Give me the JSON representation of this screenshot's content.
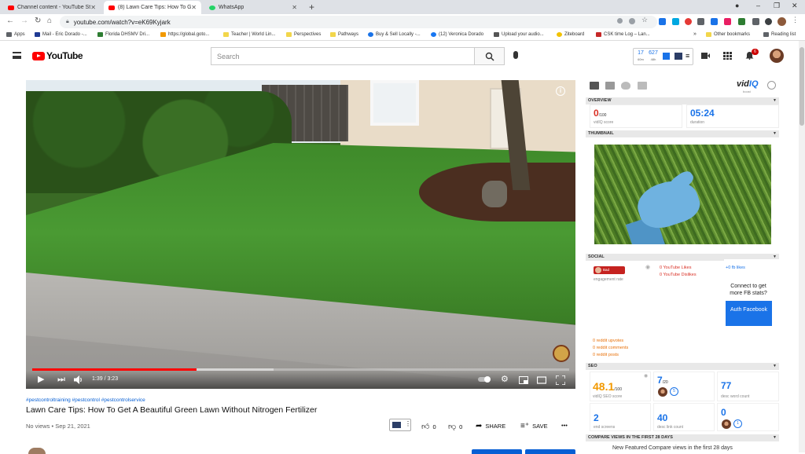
{
  "browser": {
    "tabs": [
      {
        "label": "Channel content - YouTube Studi",
        "color": "#ff0000"
      },
      {
        "label": "(8) Lawn Care Tips: How To Get A",
        "color": "#ff0000"
      },
      {
        "label": "WhatsApp",
        "color": "#25d366"
      }
    ],
    "url": "youtube.com/watch?v=eK69Kyjark",
    "bookmarks": [
      {
        "label": "Apps",
        "color": "#5f6368"
      },
      {
        "label": "Mail - Eric Dorado -...",
        "color": "#1f3a93"
      },
      {
        "label": "Florida DHSMV Dri...",
        "color": "#2e7d32"
      },
      {
        "label": "https://global.goto...",
        "color": "#f29900"
      },
      {
        "label": "Teacher | World Lin...",
        "color": "#f2d64b"
      },
      {
        "label": "Perspectives",
        "color": "#f2d64b"
      },
      {
        "label": "Pathways",
        "color": "#f2d64b"
      },
      {
        "label": "Buy & Sell Locally -...",
        "color": "#1a73e8"
      },
      {
        "label": "(12) Veronica Dorado",
        "color": "#1877f2"
      },
      {
        "label": "Upload your audio...",
        "color": "#555555"
      },
      {
        "label": "Ziteboard",
        "color": "#333333"
      },
      {
        "label": "CSK time Log – Lan...",
        "color": "#c62828"
      }
    ],
    "other_bookmarks": "Other bookmarks",
    "reading_list": "Reading list"
  },
  "youtube": {
    "logo": "YouTube",
    "search_placeholder": "Search",
    "vidiq_header": {
      "views": "17",
      "views_label": "60m",
      "subs": "627",
      "subs_label": "48h"
    },
    "notification_count": "6"
  },
  "video": {
    "time": "1:39 / 3:23",
    "progress_fraction": 0.306,
    "buffer_fraction": 0.45,
    "tags": "#pestcontroltraining #pestcontrol #pestcontrolservice",
    "title": "Lawn Care Tips: How To Get A Beautiful Green Lawn Without Nitrogen Fertilizer",
    "meta": "No views • Sep 21, 2021",
    "likes": "0",
    "dislikes": "0",
    "share": "SHARE",
    "save": "SAVE",
    "more": "•••"
  },
  "vidiq": {
    "brand": "vid",
    "brand_iq": "IQ",
    "brand_sub": "boost",
    "overview": {
      "header": "OVERVIEW",
      "score": "0",
      "score_total": "/100",
      "score_label": "vidIQ score",
      "duration": "05:24",
      "duration_label": "duration"
    },
    "thumbnail_header": "THUMBNAIL",
    "social": {
      "header": "SOCIAL",
      "badge": "Bad",
      "engagement_label": "engagement rate",
      "yt_likes": "0  YouTube Likes",
      "yt_dislikes": "0  YouTube Dislikes",
      "fb_likes": "+0  fb likes",
      "fb_prompt": "Connect to get more FB stats?",
      "auth_label": "Auth Facebook",
      "reddit_upvotes": "0  reddit upvotes",
      "reddit_comments": "0  reddit comments",
      "reddit_posts": "0  reddit posts"
    },
    "seo": {
      "header": "SEO",
      "score": "48.1",
      "score_total": "/100",
      "score_label": "vidIQ SEO score",
      "tag_count": "7",
      "tag_total": "/20",
      "desc_words": "77",
      "desc_words_label": "desc word count",
      "end_screens": "2",
      "end_screens_label": "end screens",
      "desc_links": "40",
      "desc_links_label": "desc link count",
      "third_value": "0",
      "ring_a": "5",
      "ring_b": "1"
    },
    "compare_header": "COMPARE VIEWS IN THE FIRST 28 DAYS",
    "compare_text": "New Featured Compare views in the first 28 days"
  }
}
